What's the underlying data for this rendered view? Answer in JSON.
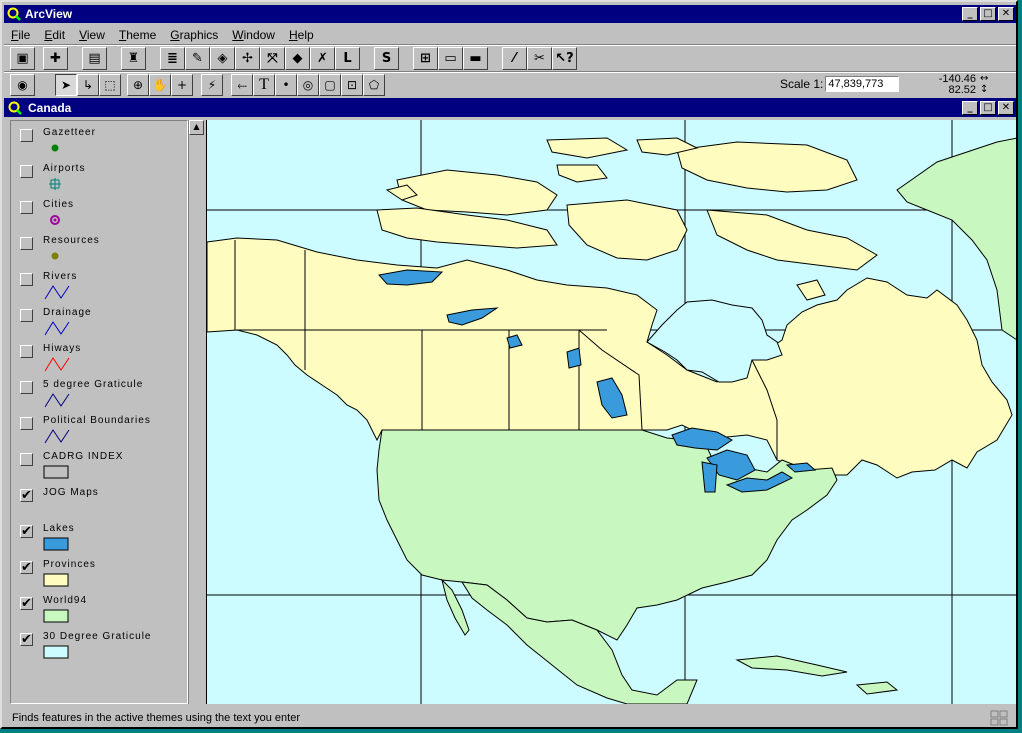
{
  "app": {
    "title": "ArcView"
  },
  "menu": [
    {
      "label": "File",
      "u": "F",
      "rest": "ile"
    },
    {
      "label": "Edit",
      "u": "E",
      "rest": "dit"
    },
    {
      "label": "View",
      "u": "V",
      "rest": "iew"
    },
    {
      "label": "Theme",
      "u": "T",
      "rest": "heme"
    },
    {
      "label": "Graphics",
      "u": "G",
      "rest": "raphics"
    },
    {
      "label": "Window",
      "u": "W",
      "rest": "indow"
    },
    {
      "label": "Help",
      "u": "H",
      "rest": "elp"
    }
  ],
  "toolbar": {
    "btn_l": "L",
    "btn_s": "S",
    "text_tool": "T"
  },
  "scale": {
    "label": "Scale 1:",
    "value": "47,839,773"
  },
  "coords": {
    "x": "-140.46",
    "y": "82.52"
  },
  "view": {
    "title": "Canada"
  },
  "layers": [
    {
      "name": "Gazetteer",
      "checked": false,
      "symbol": "dot",
      "color": "#008000"
    },
    {
      "name": "Airports",
      "checked": false,
      "symbol": "crosshair",
      "color": "#008080"
    },
    {
      "name": "Cities",
      "checked": false,
      "symbol": "ring",
      "color": "#a000a0"
    },
    {
      "name": "Resources",
      "checked": false,
      "symbol": "dot",
      "color": "#808000"
    },
    {
      "name": "Rivers",
      "checked": false,
      "symbol": "line",
      "color": "#0000c0"
    },
    {
      "name": "Drainage",
      "checked": false,
      "symbol": "line",
      "color": "#0000c0"
    },
    {
      "name": "Hiways",
      "checked": false,
      "symbol": "line",
      "color": "#ff0000"
    },
    {
      "name": "5 degree Graticule",
      "checked": false,
      "symbol": "line",
      "color": "#000080"
    },
    {
      "name": "Political Boundaries",
      "checked": false,
      "symbol": "line",
      "color": "#000080"
    },
    {
      "name": "CADRG INDEX",
      "checked": false,
      "symbol": "fill",
      "color": "#c0c0c0"
    },
    {
      "name": "JOG Maps",
      "checked": true,
      "symbol": "none",
      "color": ""
    },
    {
      "name": "Lakes",
      "checked": true,
      "symbol": "fill",
      "color": "#3a9bdc"
    },
    {
      "name": "Provinces",
      "checked": true,
      "symbol": "fill",
      "color": "#fffcc0"
    },
    {
      "name": "World94",
      "checked": true,
      "symbol": "fill",
      "color": "#c8f8c0"
    },
    {
      "name": "30 Degree Graticule",
      "checked": true,
      "symbol": "fill",
      "color": "#ccfcff"
    }
  ],
  "colors": {
    "ocean": "#ccfcff",
    "canada": "#fffcc0",
    "usa": "#c8f8c0",
    "lakes": "#3a9bdc",
    "titlebar": "#000080"
  },
  "status": {
    "message": "Finds features in the active themes using the text you enter"
  }
}
